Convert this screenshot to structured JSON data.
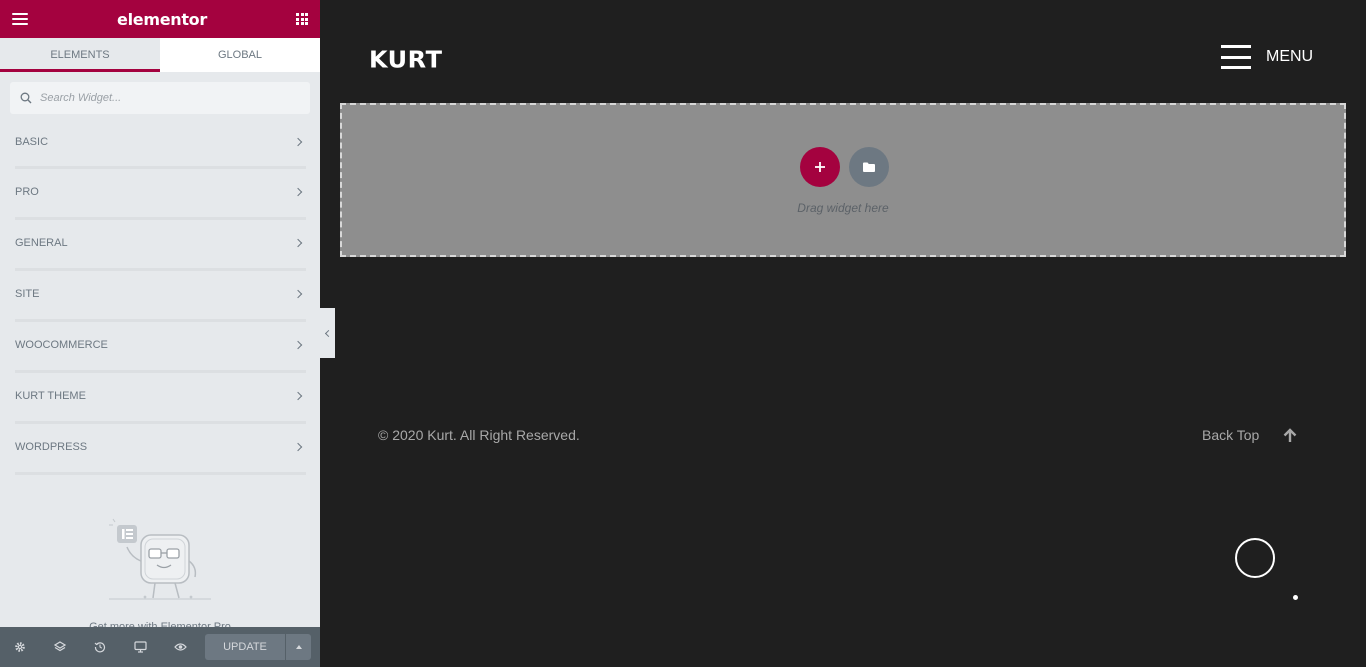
{
  "panel": {
    "logo": "elementor",
    "tabs": [
      {
        "label": "ELEMENTS",
        "active": true
      },
      {
        "label": "GLOBAL",
        "active": false
      }
    ],
    "search_placeholder": "Search Widget...",
    "categories": [
      "BASIC",
      "PRO",
      "GENERAL",
      "SITE",
      "WOOCOMMERCE",
      "KURT THEME",
      "WORDPRESS"
    ],
    "promo_text": "Get more with Elementor Pro",
    "footer": {
      "icons": [
        "settings-icon",
        "layers-icon",
        "history-icon",
        "responsive-icon",
        "preview-icon"
      ],
      "update_label": "UPDATE"
    }
  },
  "preview": {
    "brand": "KURT",
    "menu_label": "MENU",
    "drag_text": "Drag widget here",
    "copyright": "© 2020 Kurt. All Right Reserved.",
    "back_top": "Back Top"
  },
  "colors": {
    "accent": "#a4023f",
    "panel_bg": "#e6e9ec",
    "footer_bg": "#556068",
    "page_bg": "#1f1f1f",
    "dropzone_bg": "#8e8e8e"
  }
}
